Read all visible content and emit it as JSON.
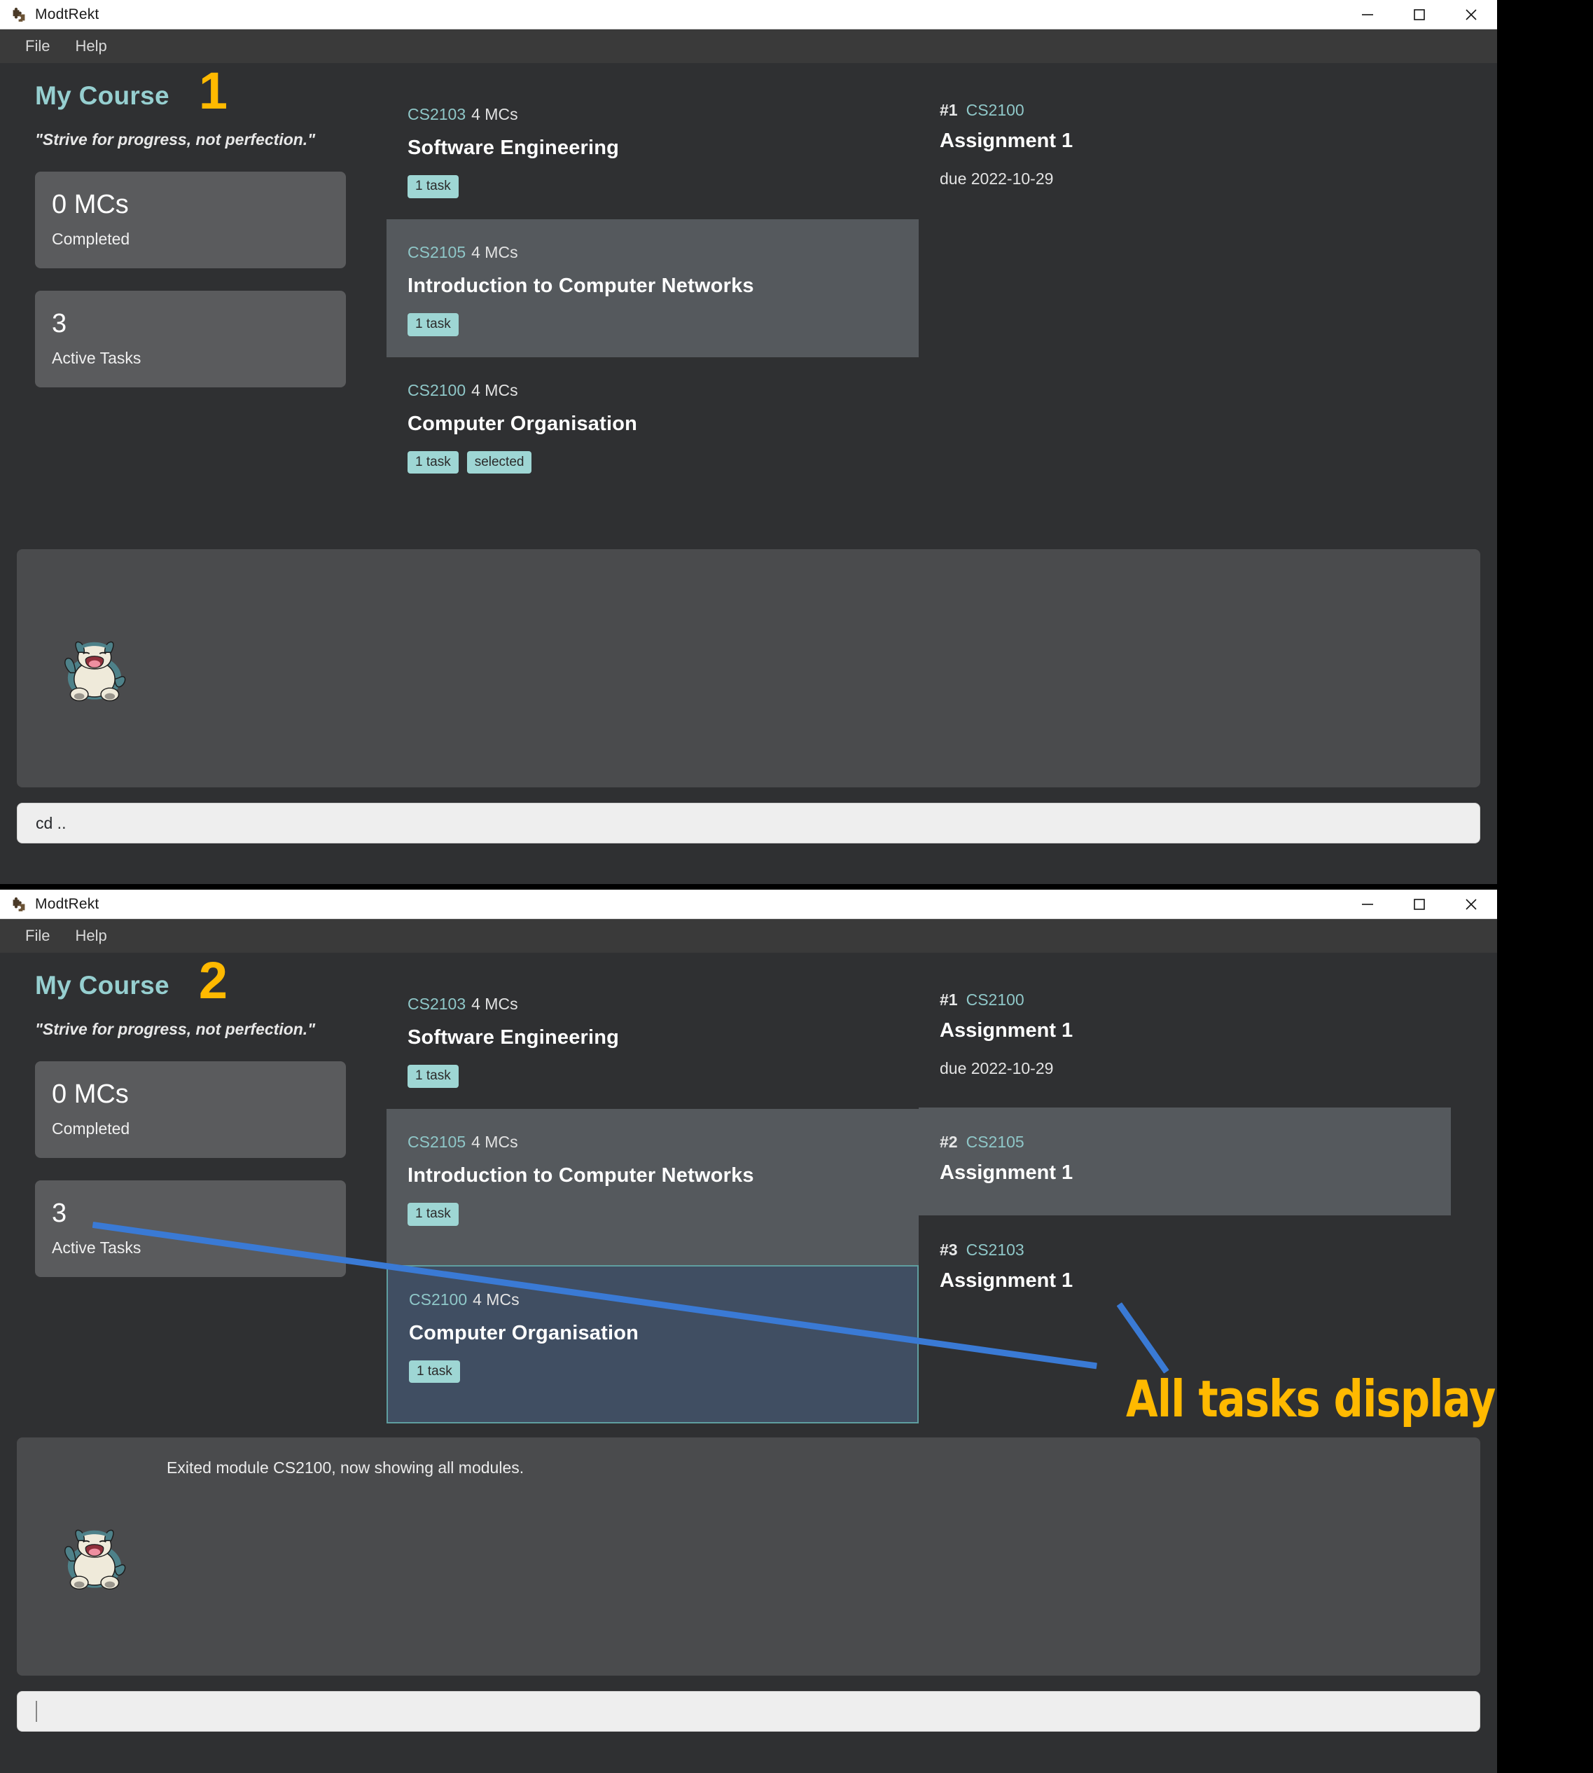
{
  "app": {
    "title": "ModtRekt",
    "icon": "puzzle-piece-icon",
    "menu": [
      "File",
      "Help"
    ],
    "window_controls": {
      "minimize": "minimize-icon",
      "maximize": "maximize-icon",
      "close": "close-icon"
    }
  },
  "windows": [
    {
      "step_number": "1",
      "sidebar": {
        "heading": "My Course",
        "quote": "\"Strive for progress, not perfection.\"",
        "stats": [
          {
            "value": "0 MCs",
            "label": "Completed"
          },
          {
            "value": "3",
            "label": "Active Tasks"
          }
        ]
      },
      "modules": [
        {
          "code": "CS2103",
          "mcs": "4 MCs",
          "name": "Software Engineering",
          "badges": [
            "1 task"
          ],
          "state": "normal"
        },
        {
          "code": "CS2105",
          "mcs": "4 MCs",
          "name": "Introduction to Computer Networks",
          "badges": [
            "1 task"
          ],
          "state": "hover"
        },
        {
          "code": "CS2100",
          "mcs": "4 MCs",
          "name": "Computer Organisation",
          "badges": [
            "1 task",
            "selected"
          ],
          "state": "normal"
        }
      ],
      "tasks": [
        {
          "index": "#1",
          "code": "CS2100",
          "name": "Assignment 1",
          "due": "due 2022-10-29",
          "state": "normal"
        }
      ],
      "console": {
        "message": "",
        "mascot": "snorlax-mascot"
      },
      "command": {
        "value": "cd ..",
        "placeholder": ""
      }
    },
    {
      "step_number": "2",
      "sidebar": {
        "heading": "My Course",
        "quote": "\"Strive for progress, not perfection.\"",
        "stats": [
          {
            "value": "0 MCs",
            "label": "Completed"
          },
          {
            "value": "3",
            "label": "Active Tasks"
          }
        ]
      },
      "modules": [
        {
          "code": "CS2103",
          "mcs": "4 MCs",
          "name": "Software Engineering",
          "badges": [
            "1 task"
          ],
          "state": "normal"
        },
        {
          "code": "CS2105",
          "mcs": "4 MCs",
          "name": "Introduction to Computer Networks",
          "badges": [
            "1 task"
          ],
          "state": "hover"
        },
        {
          "code": "CS2100",
          "mcs": "4 MCs",
          "name": "Computer Organisation",
          "badges": [
            "1 task"
          ],
          "state": "selected"
        }
      ],
      "tasks": [
        {
          "index": "#1",
          "code": "CS2100",
          "name": "Assignment 1",
          "due": "due 2022-10-29",
          "state": "normal"
        },
        {
          "index": "#2",
          "code": "CS2105",
          "name": "Assignment 1",
          "due": "",
          "state": "hover"
        },
        {
          "index": "#3",
          "code": "CS2103",
          "name": "Assignment 1",
          "due": "",
          "state": "normal"
        }
      ],
      "console": {
        "message": "Exited module CS2100, now showing all modules.",
        "mascot": "snorlax-mascot"
      },
      "command": {
        "value": "",
        "placeholder": ""
      }
    }
  ],
  "annotations": {
    "callout_text": "All tasks displayed",
    "accent_yellow": "#ffb900",
    "accent_blue": "#3a7ad5",
    "accent_teal": "#96cfd0"
  }
}
